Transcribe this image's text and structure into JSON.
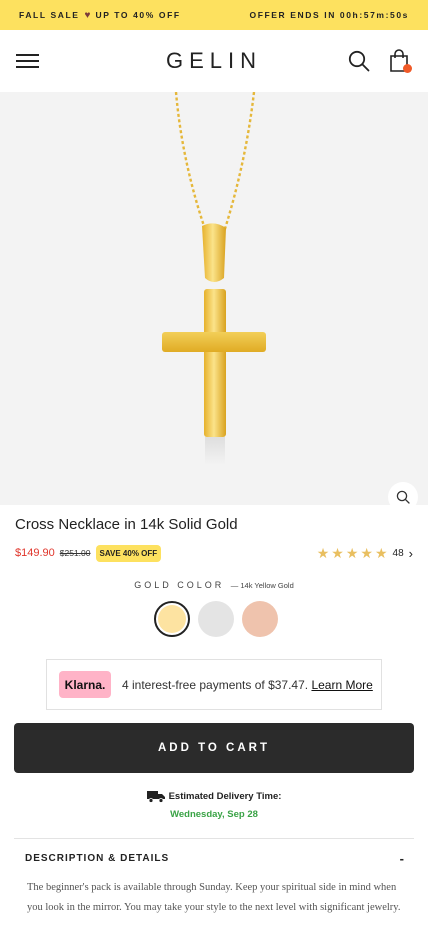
{
  "promo": {
    "left_a": "FALL SALE",
    "left_b": "UP TO 40% OFF",
    "right": "OFFER ENDS IN 00h:57m:50s"
  },
  "header": {
    "logo": "GELIN",
    "icons": [
      "hamburger-menu-icon",
      "search-icon",
      "shopping-bag-icon"
    ],
    "cart_badge_color": "#f05a28"
  },
  "product": {
    "title": "Cross Necklace in 14k Solid Gold",
    "price": "$149.90",
    "original_price": "$251.00",
    "save_badge": "SAVE 40% OFF",
    "rating": 5,
    "review_count": "48",
    "color_label": "GOLD COLOR",
    "color_value": "— 14k Yellow Gold",
    "swatches": [
      {
        "color": "#fde3a1",
        "selected": true
      },
      {
        "color": "#e4e4e4",
        "selected": false
      },
      {
        "color": "#efc3ad",
        "selected": false
      }
    ]
  },
  "klarna": {
    "logo": "Klarna.",
    "text": "4 interest-free payments of $37.47.",
    "link": "Learn More"
  },
  "cta": {
    "add_to_cart": "ADD TO CART"
  },
  "delivery": {
    "label": "Estimated Delivery Time:",
    "date": "Wednesday, Sep 28"
  },
  "description": {
    "title": "DESCRIPTION & DETAILS",
    "toggle": "-",
    "text": "The beginner's pack is available through Sunday. Keep your spiritual side in mind when you look in the mirror. You may take your style to the next level with significant jewelry."
  },
  "colors": {
    "promo_bg": "#fde15f",
    "sale_price": "#e0352b",
    "cta_bg": "#2b2b2b",
    "delivery_date": "#3aa346",
    "star": "#e9bf60",
    "klarna_pink": "#ffb3c7"
  }
}
